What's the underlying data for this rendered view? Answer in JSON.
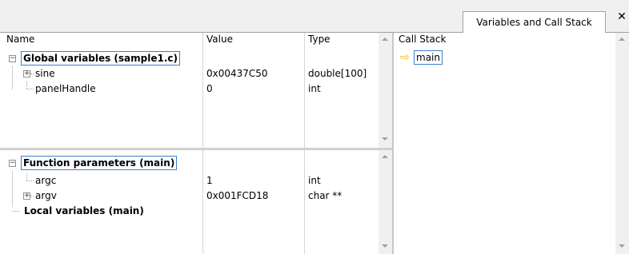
{
  "tabs": {
    "active_label": "Variables and Call Stack",
    "close_glyph": "✕"
  },
  "variables": {
    "headers": {
      "name": "Name",
      "value": "Value",
      "type": "Type"
    },
    "global_group": {
      "label": "Global variables (sample1.c)",
      "rows": [
        {
          "name": "sine",
          "value": "0x00437C50",
          "type": "double[100]",
          "expandable": true
        },
        {
          "name": "panelHandle",
          "value": "0",
          "type": "int",
          "expandable": false
        }
      ]
    },
    "params_group": {
      "label": "Function parameters (main)",
      "rows": [
        {
          "name": "argc",
          "value": "1",
          "type": "int",
          "expandable": false
        },
        {
          "name": "argv",
          "value": "0x001FCD18",
          "type": "char **",
          "expandable": true
        }
      ]
    },
    "locals_group": {
      "label": "Local variables (main)"
    }
  },
  "call_stack": {
    "header": "Call Stack",
    "frames": [
      {
        "name": "main",
        "current": true
      }
    ]
  }
}
